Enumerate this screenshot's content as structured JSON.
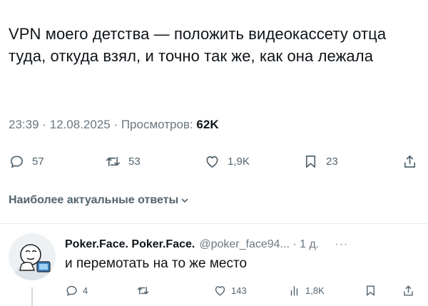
{
  "tweet": {
    "text": "VPN моего детства — положить видеокассету отца туда, откуда взял, и точно так же, как она лежала",
    "timestamp": "23:39 · 12.08.2025 · Просмотров:",
    "views": "62K",
    "actions": {
      "replies": "57",
      "retweets": "53",
      "likes": "1,9K",
      "bookmarks": "23"
    }
  },
  "replies_sort": {
    "label": "Наиболее актуальные ответы"
  },
  "reply": {
    "author_name": "Poker.Face. Poker.Face.",
    "handle_time": "@poker_face94... · 1 д.",
    "more": "···",
    "text": "и перемотать на то же место",
    "actions": {
      "replies": "4",
      "likes": "143",
      "views": "1,8K"
    }
  },
  "colors": {
    "text": "#0f1419",
    "secondary": "#53646f",
    "divider": "#e6ecf0"
  }
}
